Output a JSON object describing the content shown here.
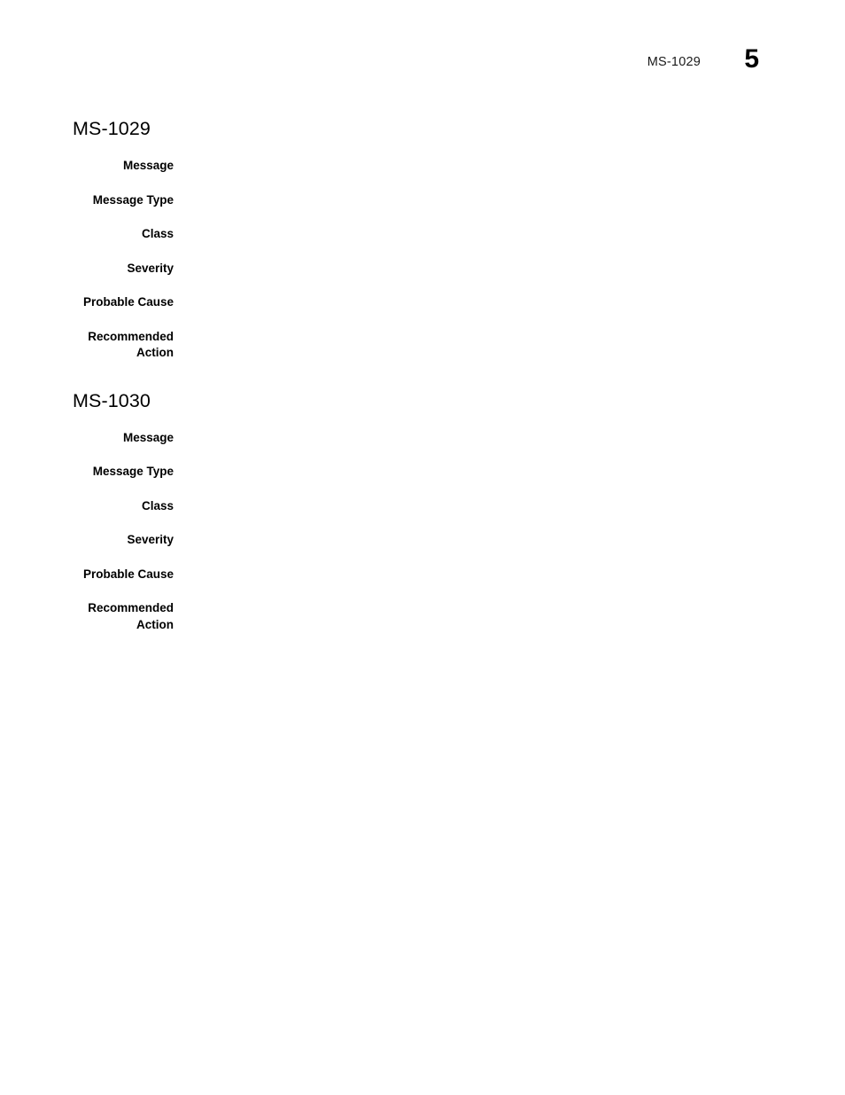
{
  "header": {
    "running_title": "MS-1029",
    "page_number": "5"
  },
  "sections": [
    {
      "heading": "MS-1029",
      "fields": [
        {
          "label": "Message",
          "value": ""
        },
        {
          "label": "Message Type",
          "value": ""
        },
        {
          "label": "Class",
          "value": ""
        },
        {
          "label": "Severity",
          "value": ""
        },
        {
          "label": "Probable Cause",
          "value": ""
        },
        {
          "label": "Recommended\nAction",
          "value": ""
        }
      ]
    },
    {
      "heading": "MS-1030",
      "fields": [
        {
          "label": "Message",
          "value": ""
        },
        {
          "label": "Message Type",
          "value": ""
        },
        {
          "label": "Class",
          "value": ""
        },
        {
          "label": "Severity",
          "value": ""
        },
        {
          "label": "Probable Cause",
          "value": ""
        },
        {
          "label": "Recommended\nAction",
          "value": ""
        }
      ]
    }
  ],
  "colors": {
    "page_background": "#ffffff",
    "text": "#000000",
    "header_text": "#1a1a1a"
  }
}
